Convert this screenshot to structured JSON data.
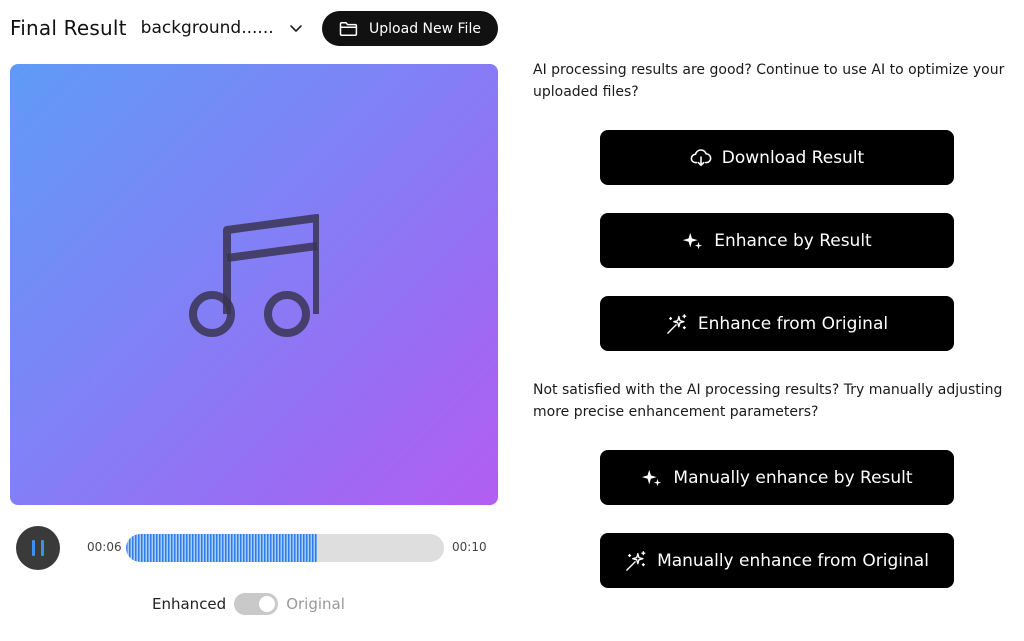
{
  "header": {
    "title": "Final Result",
    "file_name": "background......",
    "upload_label": "Upload New File"
  },
  "player": {
    "current_time": "00:06",
    "duration": "00:10",
    "progress_fraction": 0.6
  },
  "toggle": {
    "on_label": "Enhanced",
    "off_label": "Original"
  },
  "prompts": {
    "good": "AI processing results are good? Continue to use AI to optimize your uploaded files?",
    "not_satisfied": "Not satisfied with the AI processing results? Try manually adjusting more precise enhancement parameters?"
  },
  "actions": {
    "download": "Download Result",
    "enhance_by_result": "Enhance by Result",
    "enhance_from_original": "Enhance from Original",
    "manual_by_result": "Manually enhance by Result",
    "manual_from_original": "Manually enhance from Original"
  },
  "icons": {
    "folder": "folder-icon",
    "chevron": "chevron-down-icon",
    "music": "music-note-icon",
    "pause": "pause-icon",
    "download": "cloud-download-icon",
    "sparkle": "sparkle-icon",
    "magic": "magic-wand-icon"
  },
  "colors": {
    "accent": "#3f8ef5",
    "button_bg": "#000000",
    "gradient_start": "#5f9bf7",
    "gradient_end": "#b25ef1"
  }
}
